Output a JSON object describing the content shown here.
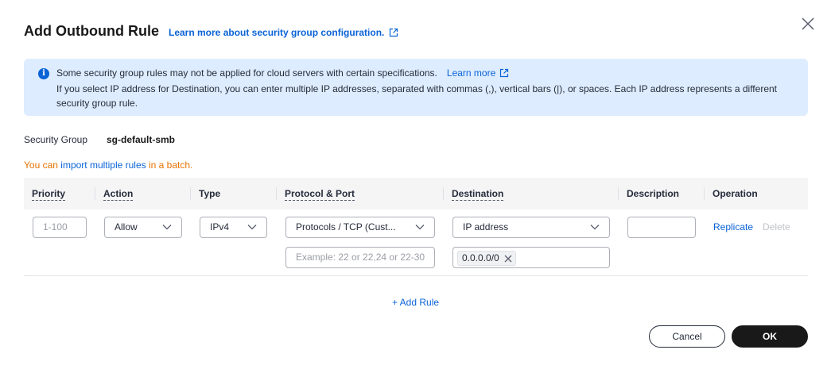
{
  "dialog": {
    "title": "Add Outbound Rule",
    "title_link": "Learn more about security group configuration."
  },
  "alert": {
    "line1": "Some security group rules may not be applied for cloud servers with certain specifications.",
    "learn_more": "Learn more",
    "line2": "If you select IP address for Destination, you can enter multiple IP addresses, separated with commas (,), vertical bars (|), or spaces. Each IP address represents a different security group rule."
  },
  "security_group": {
    "label": "Security Group",
    "value": "sg-default-smb"
  },
  "batch": {
    "prefix": "You can",
    "link": "import multiple rules",
    "suffix": "in a batch."
  },
  "table": {
    "headers": {
      "priority": "Priority",
      "action": "Action",
      "type": "Type",
      "protocol": "Protocol & Port",
      "destination": "Destination",
      "description": "Description",
      "operation": "Operation"
    },
    "row": {
      "priority_placeholder": "1-100",
      "action": "Allow",
      "type": "IPv4",
      "protocol": "Protocols / TCP (Cust...",
      "port_placeholder": "Example: 22 or 22,24 or 22-30",
      "destination_type": "IP address",
      "destination_tag": "0.0.0.0/0",
      "description": "",
      "replicate": "Replicate",
      "delete": "Delete"
    }
  },
  "add_rule": "+ Add Rule",
  "buttons": {
    "cancel": "Cancel",
    "ok": "OK"
  },
  "colors": {
    "accent": "#0a63d6",
    "warning": "#e67200",
    "alert_bg": "#ddecfe",
    "primary_button": "#191919"
  }
}
